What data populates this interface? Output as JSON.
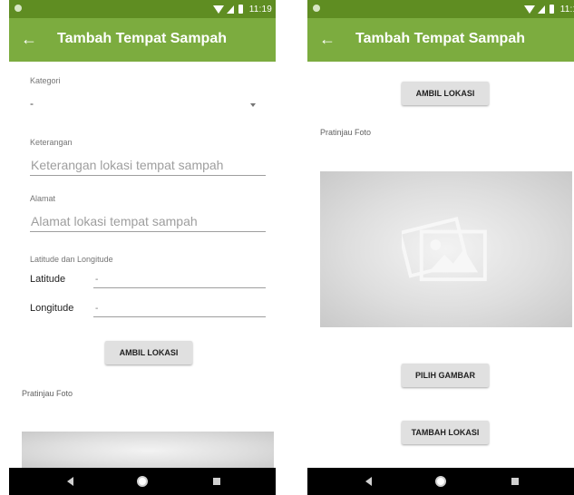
{
  "status_bar": {
    "time": "11:19"
  },
  "app_bar": {
    "back_icon": "arrow-back-icon",
    "title": "Tambah Tempat Sampah"
  },
  "form": {
    "kategori": {
      "label": "Kategori",
      "value": "-"
    },
    "keterangan": {
      "label": "Keterangan",
      "placeholder": "Keterangan lokasi tempat sampah"
    },
    "alamat": {
      "label": "Alamat",
      "placeholder": "Alamat lokasi tempat sampah"
    },
    "coordinates": {
      "label": "Latitude dan Longitude",
      "latitude_label": "Latitude",
      "latitude_value": "-",
      "longitude_label": "Longitude",
      "longitude_value": "-"
    },
    "ambil_lokasi_label": "AMBIL LOKASI",
    "preview_label": "Pratinjau Foto",
    "pilih_gambar_label": "PILIH GAMBAR",
    "tambah_lokasi_label": "TAMBAH LOKASI"
  },
  "icons": {
    "preview_placeholder": "image-gallery-icon",
    "nav_back": "nav-back-icon",
    "nav_home": "nav-home-icon",
    "nav_recents": "nav-recents-icon"
  },
  "colors": {
    "status_bar": "#5f8d22",
    "app_bar": "#7cac3f",
    "button": "#e0e0e0",
    "nav_bar": "#000000"
  }
}
